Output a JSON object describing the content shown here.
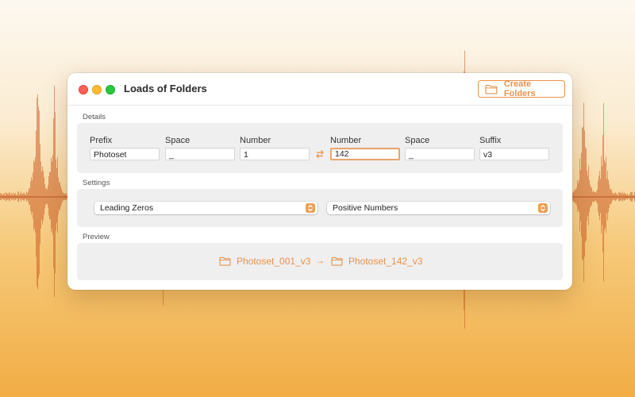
{
  "window": {
    "title": "Loads of Folders",
    "create_button_label": "Create Folders"
  },
  "details": {
    "section_label": "Details",
    "left": {
      "prefix_label": "Prefix",
      "prefix_value": "Photoset",
      "space_label": "Space",
      "space_value": "_",
      "number_label": "Number",
      "number_value": "1"
    },
    "right": {
      "number_label": "Number",
      "number_value": "142",
      "space_label": "Space",
      "space_value": "_",
      "suffix_label": "Suffix",
      "suffix_value": "v3"
    }
  },
  "settings": {
    "section_label": "Settings",
    "padding_option": "Leading Zeros",
    "sign_option": "Positive Numbers"
  },
  "preview": {
    "section_label": "Preview",
    "from_name": "Photoset_001_v3",
    "arrow": "→",
    "to_name": "Photoset_142_v3"
  },
  "colors": {
    "accent": "#e8924a",
    "focus_ring": "#e8a56b",
    "waveform": "#c9551e",
    "close": "#fe5f57",
    "minimize": "#febc2e",
    "zoom": "#28c840"
  },
  "icons": [
    "folder-icon",
    "swap-arrows-icon",
    "chevron-updown-icon",
    "arrow-right-icon"
  ]
}
